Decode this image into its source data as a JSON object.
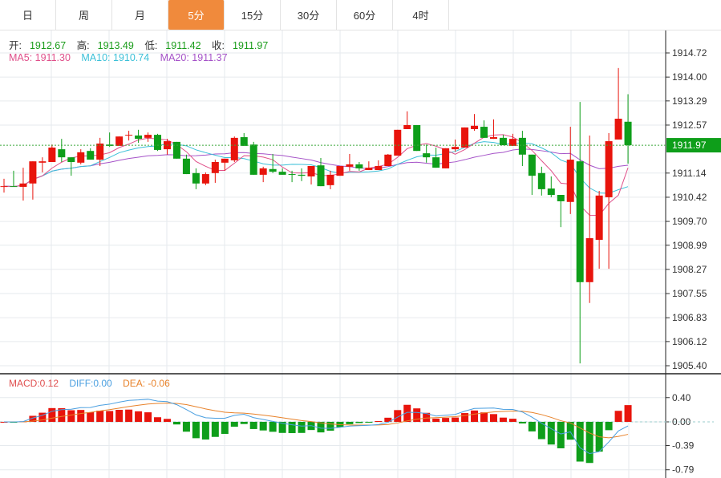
{
  "tabs": [
    {
      "label": "日",
      "active": false
    },
    {
      "label": "周",
      "active": false
    },
    {
      "label": "月",
      "active": false
    },
    {
      "label": "5分",
      "active": true
    },
    {
      "label": "15分",
      "active": false
    },
    {
      "label": "30分",
      "active": false
    },
    {
      "label": "60分",
      "active": false
    },
    {
      "label": "4时",
      "active": false
    }
  ],
  "ohlc_info": {
    "open_label": "开:",
    "open": "1912.67",
    "high_label": "高:",
    "high": "1913.49",
    "low_label": "低:",
    "low": "1911.42",
    "close_label": "收:",
    "close": "1911.97"
  },
  "ma_info": {
    "ma5": "MA5: 1911.30",
    "ma10": "MA10: 1910.74",
    "ma20": "MA20: 1911.37"
  },
  "macd_info": {
    "macd": "MACD:0.12",
    "diff": "DIFF:0.00",
    "dea": "DEA: -0.06"
  },
  "colors": {
    "up": "#e8140c",
    "down": "#0e9e1a",
    "ma5": "#e0508a",
    "ma10": "#3cc0d8",
    "ma20": "#a552c8",
    "diff": "#4a9fe0",
    "dea": "#e8822a",
    "accent": "#f08a3c"
  },
  "chart_data": {
    "type": "candlestick",
    "price_axis": {
      "ticks": [
        "1914.72",
        "1914.00",
        "1913.29",
        "1912.57",
        "1911.14",
        "1910.42",
        "1909.70",
        "1908.99",
        "1908.27",
        "1907.55",
        "1906.83",
        "1906.12",
        "1905.40"
      ],
      "range": [
        1905.4,
        1914.72
      ],
      "last_price": "1911.97"
    },
    "macd_axis": {
      "ticks": [
        "0.40",
        "0.00",
        "-0.39",
        "-0.79"
      ],
      "range": [
        -0.79,
        0.4
      ]
    },
    "ohlc": [
      [
        1910.73,
        1910.97,
        1910.56,
        1910.75
      ],
      [
        1910.75,
        1911.21,
        1910.73,
        1910.73
      ],
      [
        1910.73,
        1911.3,
        1910.32,
        1910.83
      ],
      [
        1910.83,
        1911.49,
        1910.35,
        1911.49
      ],
      [
        1911.45,
        1911.61,
        1911.16,
        1911.49
      ],
      [
        1911.47,
        1911.99,
        1911.47,
        1911.9
      ],
      [
        1911.85,
        1912.16,
        1911.47,
        1911.61
      ],
      [
        1911.61,
        1911.61,
        1911.06,
        1911.47
      ],
      [
        1911.45,
        1911.85,
        1911.4,
        1911.76
      ],
      [
        1911.8,
        1911.88,
        1911.54,
        1911.54
      ],
      [
        1911.54,
        1912.19,
        1911.35,
        1912.02
      ],
      [
        1911.99,
        1912.35,
        1911.92,
        1911.95
      ],
      [
        1911.95,
        1912.23,
        1911.95,
        1912.23
      ],
      [
        1912.26,
        1912.4,
        1912.11,
        1912.28
      ],
      [
        1912.26,
        1912.43,
        1912.04,
        1912.16
      ],
      [
        1912.19,
        1912.35,
        1912.07,
        1912.28
      ],
      [
        1912.28,
        1912.31,
        1911.8,
        1911.83
      ],
      [
        1911.85,
        1912.16,
        1911.69,
        1912.09
      ],
      [
        1912.07,
        1912.07,
        1911.57,
        1911.57
      ],
      [
        1911.57,
        1911.69,
        1911.11,
        1911.11
      ],
      [
        1911.14,
        1911.28,
        1910.66,
        1910.83
      ],
      [
        1910.83,
        1911.16,
        1910.78,
        1911.11
      ],
      [
        1911.14,
        1911.54,
        1910.85,
        1911.47
      ],
      [
        1911.45,
        1911.57,
        1911.21,
        1911.57
      ],
      [
        1911.52,
        1912.23,
        1911.47,
        1912.19
      ],
      [
        1912.21,
        1912.33,
        1911.95,
        1911.95
      ],
      [
        1911.99,
        1912.07,
        1911.09,
        1911.09
      ],
      [
        1911.09,
        1911.33,
        1910.87,
        1911.28
      ],
      [
        1911.26,
        1911.71,
        1911.14,
        1911.18
      ],
      [
        1911.18,
        1911.28,
        1911.09,
        1911.09
      ],
      [
        1911.11,
        1911.21,
        1910.87,
        1911.09
      ],
      [
        1911.09,
        1911.28,
        1910.9,
        1911.06
      ],
      [
        1911.04,
        1911.35,
        1910.8,
        1911.35
      ],
      [
        1911.37,
        1911.59,
        1910.75,
        1910.75
      ],
      [
        1910.78,
        1911.21,
        1910.66,
        1911.09
      ],
      [
        1911.06,
        1911.35,
        1911.06,
        1911.35
      ],
      [
        1911.33,
        1911.71,
        1911.21,
        1911.4
      ],
      [
        1911.4,
        1911.47,
        1911.21,
        1911.28
      ],
      [
        1911.23,
        1911.49,
        1911.23,
        1911.3
      ],
      [
        1911.23,
        1911.52,
        1911.23,
        1911.35
      ],
      [
        1911.35,
        1911.71,
        1911.35,
        1911.69
      ],
      [
        1911.66,
        1912.43,
        1911.66,
        1912.43
      ],
      [
        1912.45,
        1912.98,
        1912.45,
        1912.57
      ],
      [
        1912.57,
        1912.57,
        1911.8,
        1911.8
      ],
      [
        1911.73,
        1911.99,
        1911.45,
        1911.61
      ],
      [
        1911.61,
        1911.9,
        1911.3,
        1911.3
      ],
      [
        1911.28,
        1911.88,
        1911.28,
        1911.88
      ],
      [
        1911.85,
        1912.14,
        1911.78,
        1911.92
      ],
      [
        1911.9,
        1912.5,
        1911.9,
        1912.5
      ],
      [
        1912.45,
        1912.9,
        1912.4,
        1912.55
      ],
      [
        1912.52,
        1912.71,
        1912.19,
        1912.19
      ],
      [
        1912.16,
        1912.74,
        1912.16,
        1912.21
      ],
      [
        1912.19,
        1912.28,
        1911.97,
        1911.97
      ],
      [
        1911.95,
        1912.31,
        1911.95,
        1912.16
      ],
      [
        1912.19,
        1912.4,
        1911.35,
        1911.69
      ],
      [
        1911.69,
        1911.69,
        1910.49,
        1911.06
      ],
      [
        1911.14,
        1911.33,
        1910.47,
        1910.66
      ],
      [
        1910.68,
        1911.04,
        1910.42,
        1910.49
      ],
      [
        1910.49,
        1910.49,
        1909.53,
        1910.3
      ],
      [
        1910.28,
        1912.52,
        1909.92,
        1911.54
      ],
      [
        1911.49,
        1913.26,
        1905.47,
        1907.89
      ],
      [
        1907.89,
        1912.26,
        1907.27,
        1909.2
      ],
      [
        1909.15,
        1910.61,
        1908.29,
        1910.47
      ],
      [
        1910.42,
        1912.33,
        1908.29,
        1912.09
      ],
      [
        1912.14,
        1914.27,
        1912.14,
        1912.76
      ],
      [
        1912.67,
        1913.49,
        1911.42,
        1911.97
      ]
    ],
    "ma_periods": [
      5,
      10,
      20
    ]
  }
}
